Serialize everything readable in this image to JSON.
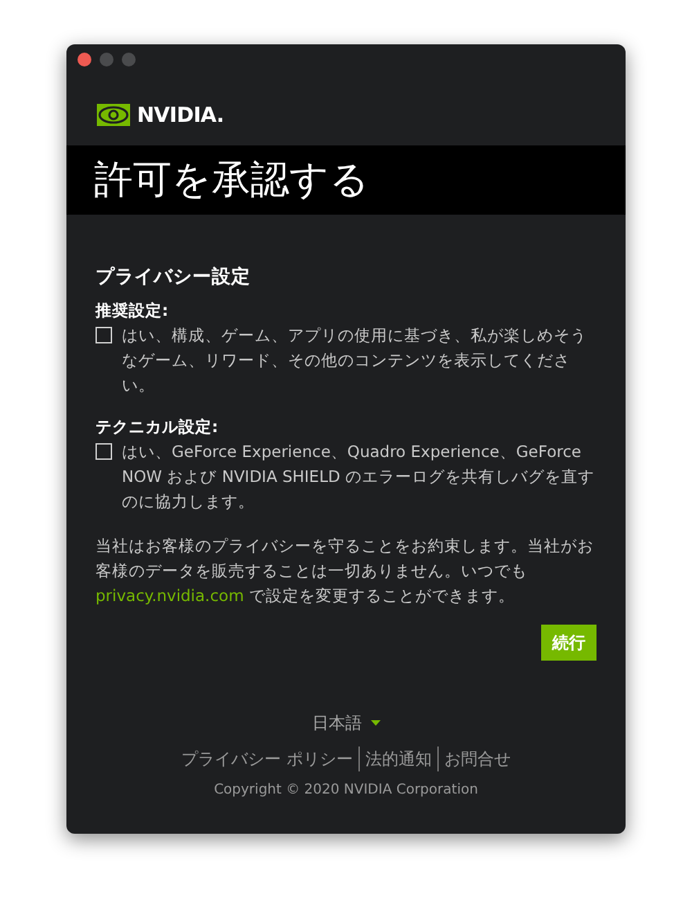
{
  "brand": {
    "name": "NVIDIA."
  },
  "header": {
    "title": "許可を承認する"
  },
  "section": {
    "title": "プライバシー設定",
    "options": [
      {
        "label": "推奨設定:",
        "text": "はい、構成、ゲーム、アプリの使用に基づき、私が楽しめそうなゲーム、リワード、その他のコンテンツを表示してください。",
        "checked": false
      },
      {
        "label": "テクニカル設定:",
        "text": "はい、GeForce Experience、Quadro Experience、GeForce NOW および NVIDIA SHIELD のエラーログを共有しバグを直すのに協力します。",
        "checked": false
      }
    ],
    "notice": {
      "before": "当社はお客様のプライバシーを守ることをお約束します。当社がお客様のデータを販売することは一切ありません。いつでも",
      "link": "privacy.nvidia.com",
      "after": " で設定を変更することができます。"
    }
  },
  "continue_button": "続行",
  "footer": {
    "language": "日本語",
    "links": [
      "プライバシー ポリシー",
      "法的通知",
      "お問合せ"
    ],
    "copyright": "Copyright © 2020 NVIDIA Corporation"
  }
}
